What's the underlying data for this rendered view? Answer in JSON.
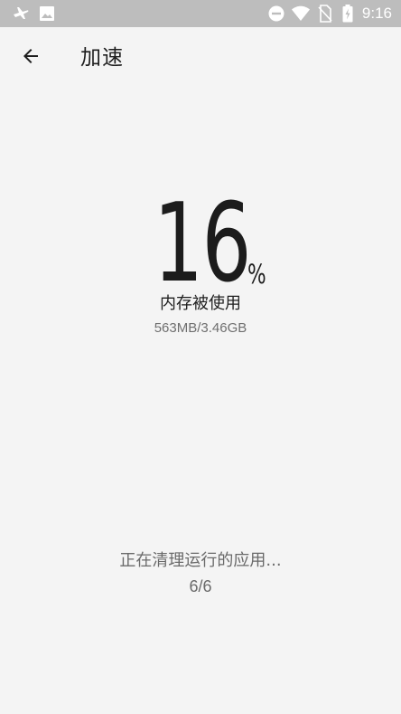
{
  "status_bar": {
    "time": "9:16",
    "icons": [
      "airplane-mode-icon",
      "image-notification-icon",
      "do-not-disturb-icon",
      "wifi-icon",
      "no-sim-icon",
      "battery-charging-icon"
    ],
    "color": "#bdbdbd"
  },
  "app_bar": {
    "back_icon": "arrow-back-icon",
    "title": "加速"
  },
  "memory": {
    "percent_value": "16",
    "percent_sign": "%",
    "label": "内存被使用",
    "detail": "563MB/3.46GB"
  },
  "progress": {
    "status_text": "正在清理运行的应用...",
    "count": "6/6"
  }
}
